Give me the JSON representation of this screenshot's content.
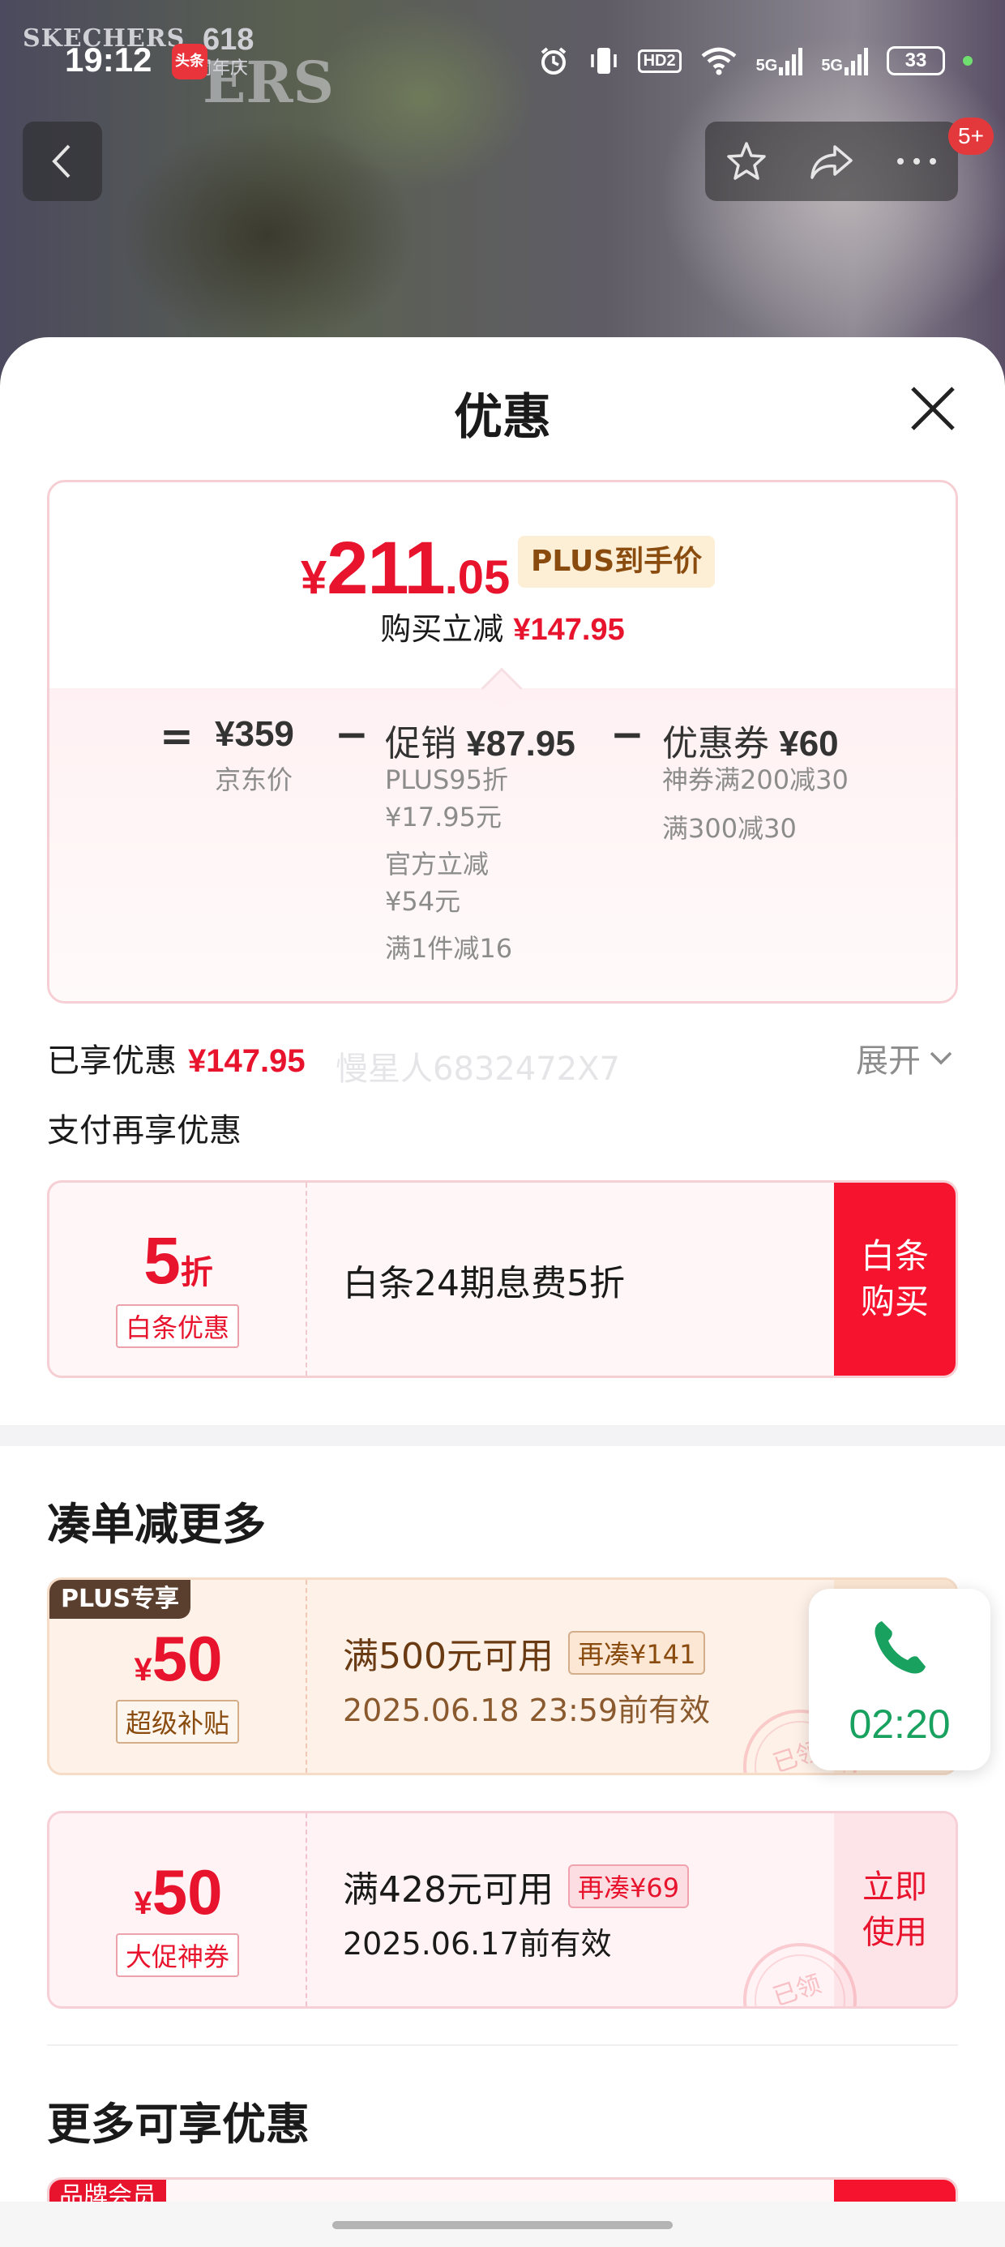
{
  "background": {
    "brand": "SKECHERS",
    "brand_big": "ERS",
    "event_num": "618",
    "event_label": "周年庆"
  },
  "status_bar": {
    "time": "19:12",
    "app_badge": "头条",
    "hd_label": "HD2",
    "sig1": "5G",
    "sig2": "5G",
    "battery": "33"
  },
  "nav": {
    "badge": "5+"
  },
  "sheet": {
    "title": "优惠"
  },
  "price": {
    "currency": "¥",
    "integer": "211",
    "decimal": ".05",
    "plus_tag": "PLUS到手价",
    "reduce_label": "购买立减",
    "reduce_amount": "¥147.95"
  },
  "breakdown": {
    "eq": "=",
    "minus1": "−",
    "minus2": "−",
    "jd_price": "¥359",
    "jd_price_label": "京东价",
    "promo_label": "促销",
    "promo_amount": "¥87.95",
    "promo_lines": [
      "PLUS95折",
      "¥17.95元",
      "官方立减",
      "¥54元",
      "满1件减16"
    ],
    "coupon_label": "优惠券",
    "coupon_amount": "¥60",
    "coupon_lines": [
      "神券满200减30",
      "满300减30"
    ]
  },
  "enjoyed": {
    "label": "已享优惠",
    "amount": "¥147.95",
    "expand": "展开",
    "watermark": "慢星人6832472X7",
    "pay_more": "支付再享优惠"
  },
  "baitiao": {
    "discount_num": "5",
    "discount_unit": "折",
    "tag": "白条优惠",
    "text": "白条24期息费5折",
    "buy_line1": "白条",
    "buy_line2": "购买"
  },
  "section_more_orders": "凑单减更多",
  "coupons": [
    {
      "corner": "PLUS专享",
      "currency": "¥",
      "amount": "50",
      "tag": "超级补贴",
      "condition": "满500元可用",
      "more": "再凑¥141",
      "valid": "2025.06.18 23:59前有效",
      "stamp": "已领"
    },
    {
      "currency": "¥",
      "amount": "50",
      "tag": "大促神券",
      "condition": "满428元可用",
      "more": "再凑¥69",
      "valid": "2025.06.17前有效",
      "action_line1": "立即",
      "action_line2": "使用",
      "stamp": "已领"
    }
  ],
  "section_more_offers": "更多可享优惠",
  "peek": {
    "tag": "品牌会员"
  },
  "timer": {
    "time": "02:20"
  },
  "colors": {
    "accent_red": "#e8132c",
    "gold_text": "#8a4b0f",
    "timer_green": "#19a15f"
  }
}
